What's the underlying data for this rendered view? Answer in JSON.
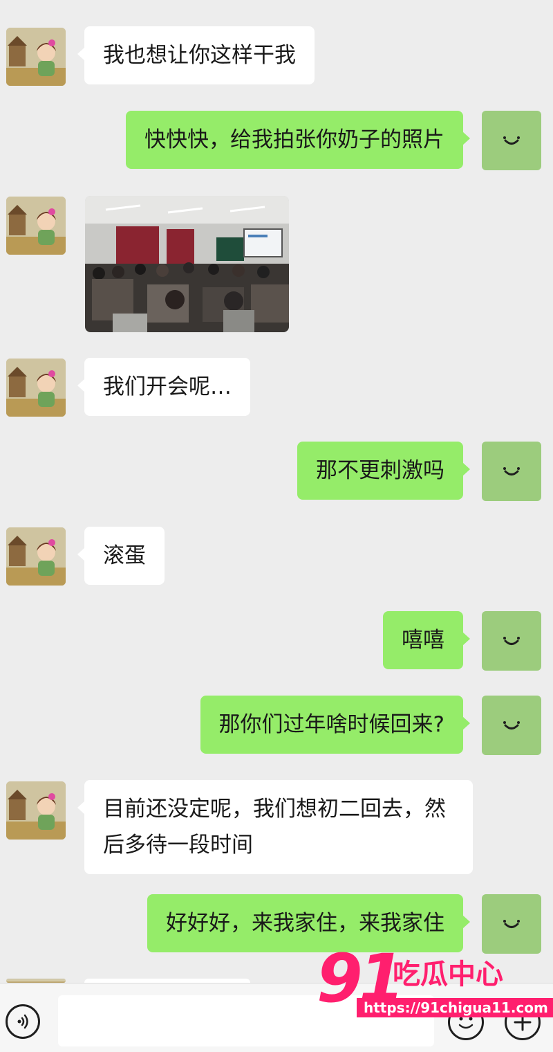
{
  "messages": [
    {
      "side": "in",
      "type": "text",
      "text": "我也想让你这样干我"
    },
    {
      "side": "out",
      "type": "text",
      "text": "快快快，给我拍张你奶子的照片"
    },
    {
      "side": "in",
      "type": "image",
      "alt": ""
    },
    {
      "side": "in",
      "type": "text",
      "text": "我们开会呢…"
    },
    {
      "side": "out",
      "type": "text",
      "text": "那不更刺激吗"
    },
    {
      "side": "in",
      "type": "text",
      "text": "滚蛋"
    },
    {
      "side": "out",
      "type": "text",
      "text": "嘻嘻"
    },
    {
      "side": "out",
      "type": "text",
      "text": "那你们过年啥时候回来?"
    },
    {
      "side": "in",
      "type": "text",
      "text": "目前还没定呢，我们想初二回去，然后多待一段时间"
    },
    {
      "side": "out",
      "type": "text",
      "text": "好好好，来我家住，来我家住"
    }
  ],
  "input": {
    "value": "",
    "placeholder": ""
  },
  "icons": {
    "voice": "voice-icon",
    "emoji": "emoji-icon",
    "plus": "plus-icon",
    "self_avatar": "smiley-icon"
  },
  "watermark": {
    "number": "91",
    "title": "吃瓜中心",
    "url": "https://91chigua11.com"
  },
  "colors": {
    "background": "#ededed",
    "incoming": "#ffffff",
    "outgoing": "#95ec69",
    "self_avatar": "#9ccc7d",
    "watermark": "#ff1f6e"
  }
}
